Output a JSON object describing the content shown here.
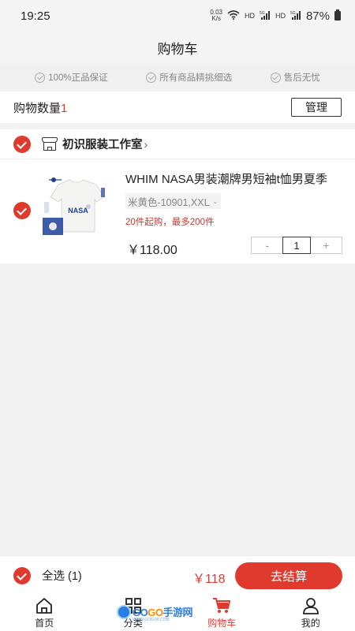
{
  "status_bar": {
    "time": "19:25",
    "net_speed_value": "0.03",
    "net_speed_unit": "K/s",
    "signal1": "HD",
    "signal1_gen": "5G",
    "signal2": "HD",
    "signal2_gen": "5G",
    "battery": "87%"
  },
  "nav": {
    "title": "购物车"
  },
  "guarantees": [
    {
      "label": "100%正品保证",
      "icon": "check-circle-icon"
    },
    {
      "label": "所有商品精挑细选",
      "icon": "check-circle-icon"
    },
    {
      "label": "售后无忧",
      "icon": "check-circle-icon"
    }
  ],
  "cart_count": {
    "label": "购物数量",
    "value": "1",
    "manage_label": "管理"
  },
  "shop": {
    "name": "初识服装工作室",
    "chevron": "›",
    "selected": true,
    "product": {
      "title": "WHIM NASA男装潮牌男短袖t恤男夏季",
      "sku": "米黄色-10901,XXL",
      "sku_chevron": "⌄",
      "limit": "20件起购，最多200件",
      "price": "￥118.00",
      "quantity": "1",
      "minus": "-",
      "plus": "+",
      "image_text": "NASA",
      "selected": true
    }
  },
  "checkout": {
    "select_all_label": "全选 (1)",
    "total": "￥118",
    "button_label": "去结算"
  },
  "tabs": [
    {
      "label": "首页",
      "icon": "home-icon",
      "active": false
    },
    {
      "label": "分类",
      "icon": "category-grid-icon",
      "active": false
    },
    {
      "label": "购物车",
      "icon": "cart-icon",
      "active": true
    },
    {
      "label": "我的",
      "icon": "user-icon",
      "active": false
    }
  ],
  "watermark": {
    "text_a": "GO",
    "text_b": "GO",
    "text_c": "手游网",
    "sub": "WWW.GOGO8.COM"
  },
  "colors": {
    "accent": "#e03a2f",
    "background": "#f2f2f2"
  }
}
